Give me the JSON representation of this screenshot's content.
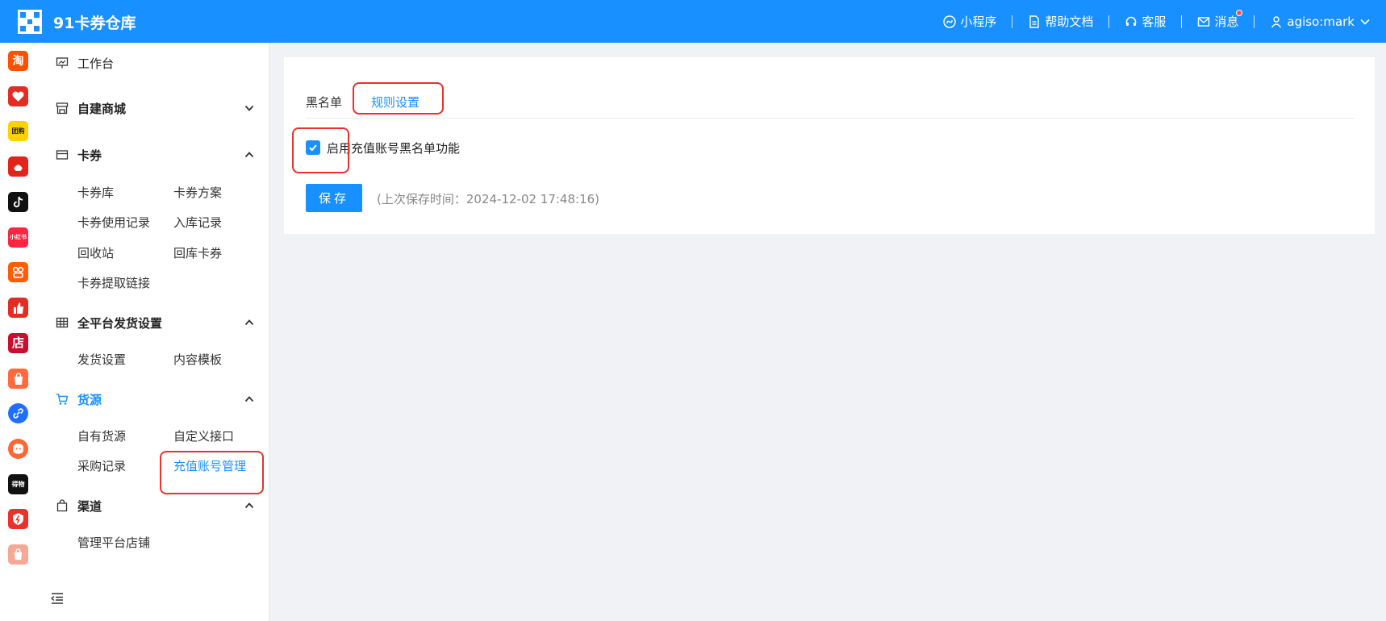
{
  "header": {
    "title": "91卡券仓库",
    "nav": {
      "mini_program": "小程序",
      "help_docs": "帮助文档",
      "support": "客服",
      "messages": "消息",
      "user": "agiso:mark"
    },
    "accent": "#1890ff"
  },
  "rail": {
    "icons": [
      "taobao-icon",
      "pinduoduo-icon",
      "tuanhao-icon",
      "jingdong-icon",
      "douyin-icon",
      "xiaohongshu-icon",
      "kuaishou-icon",
      "thumbs-up-icon",
      "store-icon",
      "bag-icon",
      "link-icon",
      "chat-icon",
      "dewu-icon",
      "shield-icon",
      "shopee-icon"
    ],
    "labels": {
      "taobao": "淘",
      "tuanhao": "团购",
      "xiaohongshu": "小红书",
      "store": "店",
      "dewu": "得物"
    }
  },
  "sidebar": {
    "workbench": "工作台",
    "self_mall": "自建商城",
    "cards": {
      "label": "卡券",
      "items": [
        "卡券库",
        "卡券方案",
        "卡券使用记录",
        "入库记录",
        "回收站",
        "回库卡券",
        "卡券提取链接"
      ]
    },
    "delivery": {
      "label": "全平台发货设置",
      "items": [
        "发货设置",
        "内容模板"
      ]
    },
    "supply": {
      "label": "货源",
      "items": [
        "自有货源",
        "自定义接口",
        "采购记录",
        "充值账号管理"
      ]
    },
    "channel": {
      "label": "渠道",
      "items": [
        "管理平台店铺"
      ]
    }
  },
  "main": {
    "tabs": [
      "黑名单",
      "规则设置"
    ],
    "active_tab": "规则设置",
    "checkbox": {
      "label": "启用充值账号黑名单功能",
      "checked": true
    },
    "save_label": "保存",
    "save_hint": "(上次保存时间：2024-12-02 17:48:16)"
  }
}
